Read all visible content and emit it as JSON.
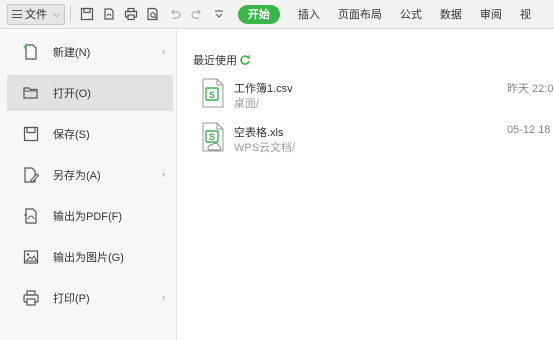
{
  "toolbar": {
    "file_label": "文件",
    "tabs": [
      "开始",
      "插入",
      "页面布局",
      "公式",
      "数据",
      "审阅",
      "视"
    ]
  },
  "menu": {
    "items": [
      {
        "label": "新建(N)",
        "icon": "new-file-icon",
        "has_submenu": true
      },
      {
        "label": "打开(O)",
        "icon": "folder-open-icon",
        "has_submenu": false,
        "active": true
      },
      {
        "label": "保存(S)",
        "icon": "save-icon",
        "has_submenu": false
      },
      {
        "label": "另存为(A)",
        "icon": "save-as-icon",
        "has_submenu": true
      },
      {
        "label": "输出为PDF(F)",
        "icon": "export-pdf-icon",
        "has_submenu": false
      },
      {
        "label": "输出为图片(G)",
        "icon": "export-image-icon",
        "has_submenu": false
      },
      {
        "label": "打印(P)",
        "icon": "print-icon",
        "has_submenu": true
      }
    ]
  },
  "recent": {
    "title": "最近使用",
    "files": [
      {
        "name": "工作簿1.csv",
        "path": "桌面/",
        "time": "昨天 22:0",
        "icon": "spreadsheet-file-icon"
      },
      {
        "name": "空表格.xls",
        "path": "WPS云文档/",
        "time": "05-12 18",
        "icon": "cloud-spreadsheet-file-icon"
      }
    ]
  },
  "colors": {
    "accent": "#39b54a",
    "toolbar_bg": "#f3f3f3",
    "menu_bg": "#f7f7f7",
    "active_item": "#e2e2e2"
  }
}
